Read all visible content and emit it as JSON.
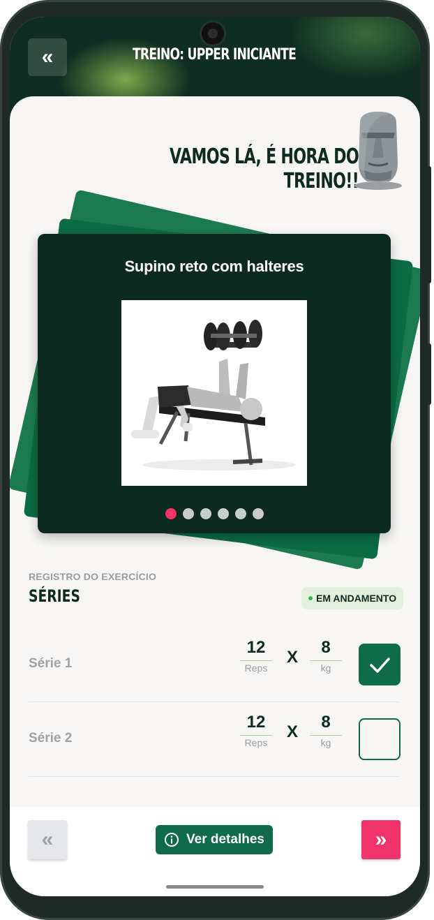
{
  "header": {
    "title": "TREINO: UPPER INICIANTE",
    "back_icon": "double-chevron-left"
  },
  "greeting": "VAMOS LÁ, É HORA DO TREINO!!",
  "mascot_icon": "moai",
  "carousel": {
    "exercise_name": "Supino reto com halteres",
    "image_icon": "dumbbell-bench-press",
    "total_pages": 6,
    "current_page": 1
  },
  "series_section": {
    "overline": "REGISTRO DO EXERCÍCIO",
    "title": "SÉRIES",
    "status": "EM ANDAMENTO",
    "times_symbol": "X",
    "rows": [
      {
        "label": "Série 1",
        "reps": "12",
        "reps_unit": "Reps",
        "weight": "8",
        "weight_unit": "kg",
        "done": true
      },
      {
        "label": "Série 2",
        "reps": "12",
        "reps_unit": "Reps",
        "weight": "8",
        "weight_unit": "kg",
        "done": false
      }
    ]
  },
  "footer": {
    "details_label": "Ver detalhes",
    "prev_icon": "double-chevron-left",
    "next_icon": "double-chevron-right",
    "info_icon": "info-circle"
  },
  "colors": {
    "dark_green": "#0d2a21",
    "accent_green": "#0f6b4a",
    "pink": "#f0336a",
    "background": "#f7f6f4"
  }
}
